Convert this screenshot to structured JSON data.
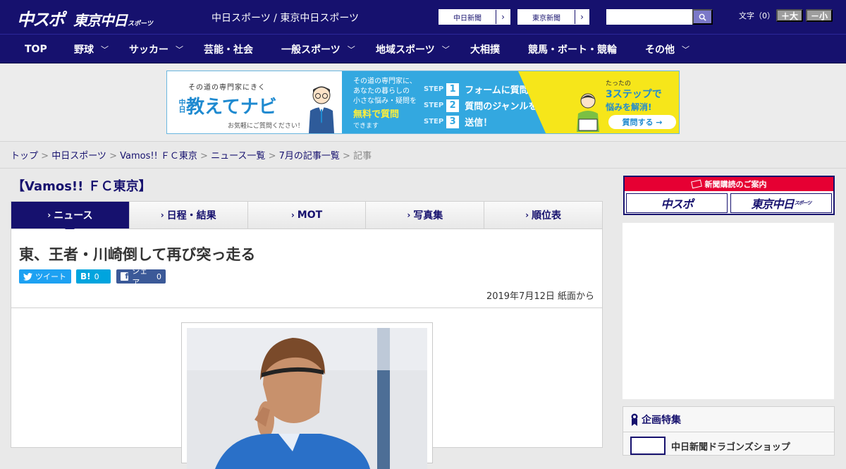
{
  "header": {
    "logo_main": "中スポ",
    "logo_sub": "東京中日",
    "logo_small": "スポーツ",
    "site_title": "中日スポーツ / 東京中日スポーツ",
    "paper_links": [
      {
        "label": "中日新聞"
      },
      {
        "label": "東京新聞"
      }
    ],
    "search_placeholder": "",
    "font_size_label": "文字（0）",
    "font_larger": "＋大",
    "font_smaller": "－小"
  },
  "nav": {
    "items": [
      {
        "label": "TOP",
        "dropdown": false
      },
      {
        "label": "野球",
        "dropdown": true
      },
      {
        "label": "サッカー",
        "dropdown": true
      },
      {
        "label": "芸能・社会",
        "dropdown": false
      },
      {
        "label": "一般スポーツ",
        "dropdown": true
      },
      {
        "label": "地域スポーツ",
        "dropdown": true
      },
      {
        "label": "大相撲",
        "dropdown": false
      },
      {
        "label": "競馬・ボート・競輪",
        "dropdown": false
      },
      {
        "label": "その他",
        "dropdown": true
      }
    ]
  },
  "banner": {
    "tagline": "その道の専門家にきく",
    "brand_prefix": "中日",
    "brand": "教えてナビ",
    "cta_small": "お気軽にご質問ください！",
    "mid_text_1": "その道の専門家に、",
    "mid_text_2": "あなたの暮らしの",
    "mid_text_3": "小さな悩み・疑問を",
    "mid_highlight": "無料で質問",
    "mid_tail": "できます",
    "steps": [
      {
        "label": "STEP",
        "num": "1",
        "text": "フォームに質問内容を入力"
      },
      {
        "label": "STEP",
        "num": "2",
        "text": "質問のジャンルを選択"
      },
      {
        "label": "STEP",
        "num": "3",
        "text": "送信！"
      }
    ],
    "right_1": "たったの",
    "right_2": "3ステップで",
    "right_3": "悩みを解消!",
    "right_button": "質問する →"
  },
  "breadcrumb": {
    "items": [
      "トップ",
      "中日スポーツ",
      "Vamos!! ＦＣ東京",
      "ニュース一覧",
      "7月の記事一覧"
    ],
    "current": "記事",
    "separator": " > "
  },
  "main": {
    "section_title": "【Vamos!! ＦＣ東京】",
    "tabs": [
      {
        "label": "ニュース",
        "active": true
      },
      {
        "label": "日程・結果",
        "active": false
      },
      {
        "label": "MOT",
        "active": false
      },
      {
        "label": "写真集",
        "active": false
      },
      {
        "label": "順位表",
        "active": false
      }
    ],
    "headline": "東、王者・川崎倒して再び突っ走る",
    "share": {
      "tweet": "ツイート",
      "hatena_icon": "B!",
      "hatena_count": "0",
      "facebook_label": "シェア",
      "facebook_count": "0"
    },
    "dateline": "2019年7月12日 紙面から"
  },
  "sidebar": {
    "subscribe_title": "新聞購読のご案内",
    "subscribe_buttons": [
      "中スポ",
      "東京中日"
    ],
    "subscribe_small": "スポーツ",
    "feature_title": "企画特集",
    "feature_item": "中日新聞ドラゴンズショップ"
  },
  "colors": {
    "brand_navy": "#16116e",
    "twitter": "#1da1f2",
    "hatena": "#00a4de",
    "facebook": "#3b5998",
    "subscribe_red": "#e60033"
  }
}
